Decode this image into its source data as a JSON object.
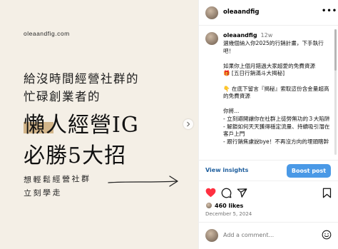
{
  "post": {
    "image": {
      "handle": "oleaandfig.com",
      "line1": "給沒時間經營社群的",
      "line2": "忙碌創業者的",
      "big1": "懶人經營IG",
      "big2": "必勝5大招",
      "hand1": "想輕鬆經營社群",
      "hand2": "立刻學走",
      "highlight_color": "#c8a26a"
    },
    "header": {
      "username": "oleaandfig",
      "more": "•••"
    },
    "caption": {
      "username": "oleaandfig",
      "time": "12w",
      "lines": [
        "選幾個納入你2025的行銷計畫，下手執行吧！",
        "",
        "如果你上個月錯過大家超愛的免費資源",
        "🎁 [五日行銷滿斗大揭秘]",
        "",
        "👇 在底下留言『揭秘』索取這份含金量超高的免費資源",
        "",
        "你將...",
        "- 立刻避開讓你在社群上徒勞無功的３大陷阱",
        "- 解鎖如何天天獲得穩定流量、持續吸引潛在客戶上門",
        "- 跟行銷焦慮說bye！不再沒方向的埋頭瞎幹"
      ]
    },
    "insights": {
      "view_label": "View insights",
      "boost_label": "Boost post"
    },
    "likes_text": "460 likes",
    "date": "December 5, 2024",
    "comment_placeholder": "Add a comment...",
    "colors": {
      "accent_blue": "#4a99e6",
      "like_red": "#ff3040",
      "link_blue": "#1f5f9e"
    }
  }
}
